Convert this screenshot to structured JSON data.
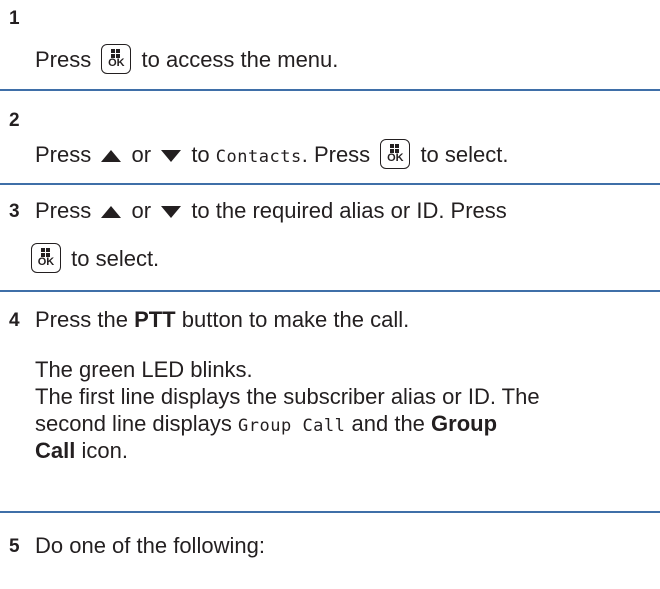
{
  "steps": [
    {
      "number": "1",
      "press": "Press",
      "after_ok": "to access the menu."
    },
    {
      "number": "2",
      "press": "Press",
      "or": "or",
      "to": "to",
      "menu_item": "Contacts",
      "dot": ".",
      "press2": "Press",
      "after_ok": "to select."
    },
    {
      "number": "3",
      "press": "Press",
      "or": "or",
      "after_arrows": "to the required alias or ID. Press",
      "after_ok": "to select."
    },
    {
      "number": "4",
      "press": "Press the",
      "ptt": "PTT",
      "after_ptt": "button to make the call.",
      "result_line1": "The green LED blinks.",
      "result_line2": "The first line displays the subscriber alias or ID. The",
      "result_line3_pre": "second line displays",
      "group_call_text": "Group Call",
      "result_line3_mid": "and the",
      "group_bold_1": "Group",
      "group_bold_2": "Call",
      "result_line4_post": "icon."
    },
    {
      "number": "5",
      "text": "Do one of the following:"
    }
  ],
  "ok_key": {
    "label": "OK",
    "icon": "menu-ok-key-icon"
  },
  "icons": {
    "up": "up-arrow-icon",
    "down": "down-arrow-icon"
  },
  "colors": {
    "rule": "#3f6fa8",
    "text": "#231f20"
  }
}
